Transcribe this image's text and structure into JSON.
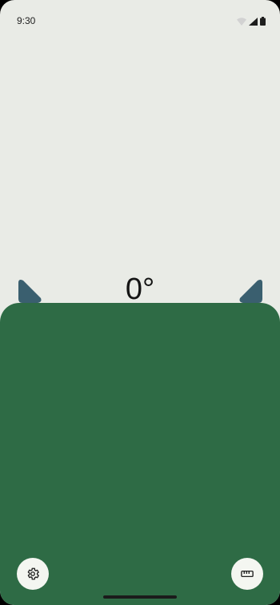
{
  "status_bar": {
    "time": "9:30",
    "icons": [
      "wifi-icon",
      "cellular-signal-icon",
      "battery-icon"
    ]
  },
  "level": {
    "angle_text": "0°",
    "angle_value": 0
  },
  "buttons": {
    "settings_icon": "gear-icon",
    "ruler_icon": "ruler-icon"
  },
  "colors": {
    "background": "#e9ebe6",
    "panel": "#2e6b45",
    "marker": "#3a5f6f",
    "fab": "#f4f6f1"
  }
}
